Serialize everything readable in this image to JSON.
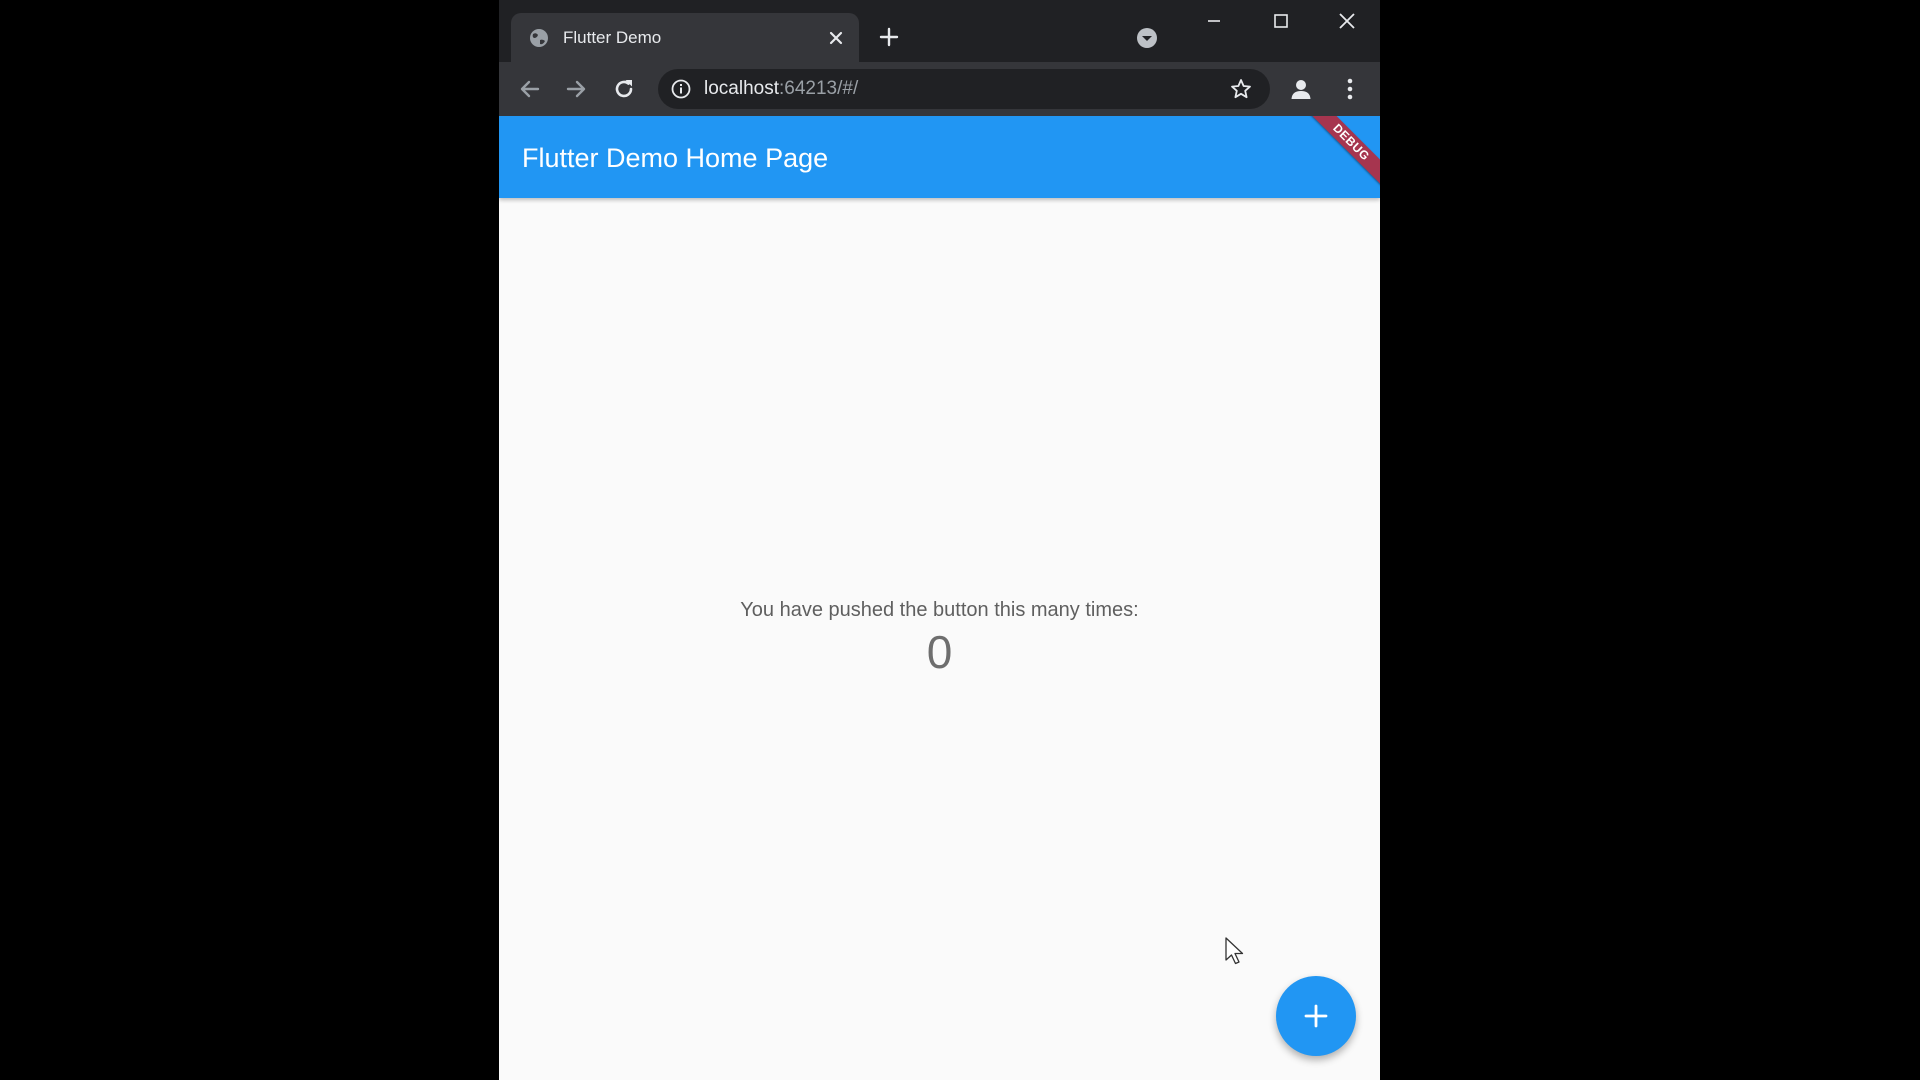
{
  "browser": {
    "tab": {
      "title": "Flutter Demo",
      "favicon": "globe-icon"
    },
    "controls": {
      "new_tab_icon": "plus-icon",
      "tab_search_icon": "chevron-down-icon",
      "minimize_icon": "minimize-icon",
      "maximize_icon": "maximize-icon",
      "close_icon": "close-icon"
    },
    "toolbar": {
      "back_icon": "arrow-left-icon",
      "forward_icon": "arrow-right-icon",
      "reload_icon": "reload-icon",
      "url_host": "localhost",
      "url_rest": ":64213/#/",
      "bookmark_icon": "star-icon",
      "profile_icon": "person-icon",
      "menu_icon": "kebab-icon"
    }
  },
  "app": {
    "title": "Flutter Demo Home Page",
    "debug_banner": "DEBUG",
    "counter_label": "You have pushed the button this many times:",
    "counter_value": "0",
    "fab_icon": "plus-icon"
  },
  "colors": {
    "primary": "#2196f3",
    "debug_banner": "#a6354f",
    "chrome_dark": "#202124",
    "chrome_toolbar": "#35363a",
    "page_background": "#fafafa"
  }
}
